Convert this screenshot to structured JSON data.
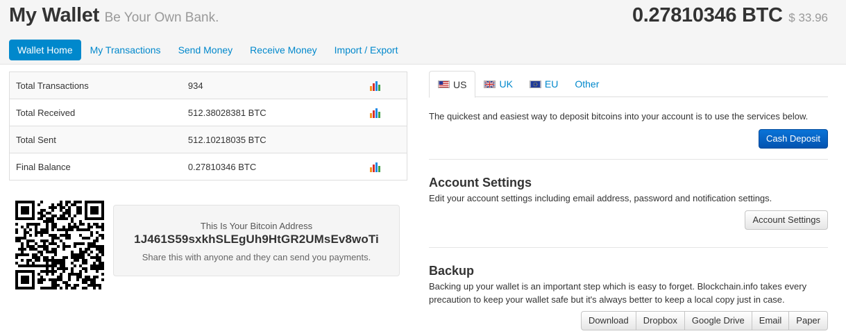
{
  "header": {
    "title": "My Wallet",
    "tagline": "Be Your Own Bank.",
    "balance_btc": "0.27810346 BTC",
    "balance_usd": "$ 33.96"
  },
  "nav": {
    "items": [
      {
        "label": "Wallet Home",
        "active": true
      },
      {
        "label": "My Transactions",
        "active": false
      },
      {
        "label": "Send Money",
        "active": false
      },
      {
        "label": "Receive Money",
        "active": false
      },
      {
        "label": "Import / Export",
        "active": false
      }
    ]
  },
  "stats": {
    "rows": [
      {
        "label": "Total Transactions",
        "value": "934",
        "chart_icon": true
      },
      {
        "label": "Total Received",
        "value": "512.38028381 BTC",
        "chart_icon": true
      },
      {
        "label": "Total Sent",
        "value": "512.10218035 BTC",
        "chart_icon": false
      },
      {
        "label": "Final Balance",
        "value": "0.27810346 BTC",
        "chart_icon": true
      }
    ],
    "chart_icon_name": "bar-chart-icon",
    "chart_icon_colors": [
      "#f7931e",
      "#d32f2f",
      "#1e88e5",
      "#43a047"
    ]
  },
  "qr": {
    "icon_name": "qr-code-icon"
  },
  "address": {
    "label": "This Is Your Bitcoin Address",
    "value": "1J461S59sxkhSLEgUh9HtGR2UMsEv8woTi",
    "hint": "Share this with anyone and they can send you payments."
  },
  "deposit": {
    "tabs": [
      {
        "label": "US",
        "flag": "us-flag-icon",
        "active": true
      },
      {
        "label": "UK",
        "flag": "uk-flag-icon",
        "active": false
      },
      {
        "label": "EU",
        "flag": "eu-flag-icon",
        "active": false
      },
      {
        "label": "Other",
        "flag": null,
        "active": false
      }
    ],
    "text": "The quickest and easiest way to deposit bitcoins into your account is to use the services below.",
    "button": "Cash Deposit"
  },
  "account_settings": {
    "title": "Account Settings",
    "text": "Edit your account settings including email address, password and notification settings.",
    "button": "Account Settings"
  },
  "backup": {
    "title": "Backup",
    "text": "Backing up your wallet is an important step which is easy to forget. Blockchain.info takes every precaution to keep your wallet safe but it's always better to keep a local copy just in case.",
    "buttons": [
      "Download",
      "Dropbox",
      "Google Drive",
      "Email",
      "Paper"
    ]
  },
  "colors": {
    "accent": "#0088cc",
    "primary_button": "#0b62c4",
    "header_bg": "#f5f5f5"
  }
}
